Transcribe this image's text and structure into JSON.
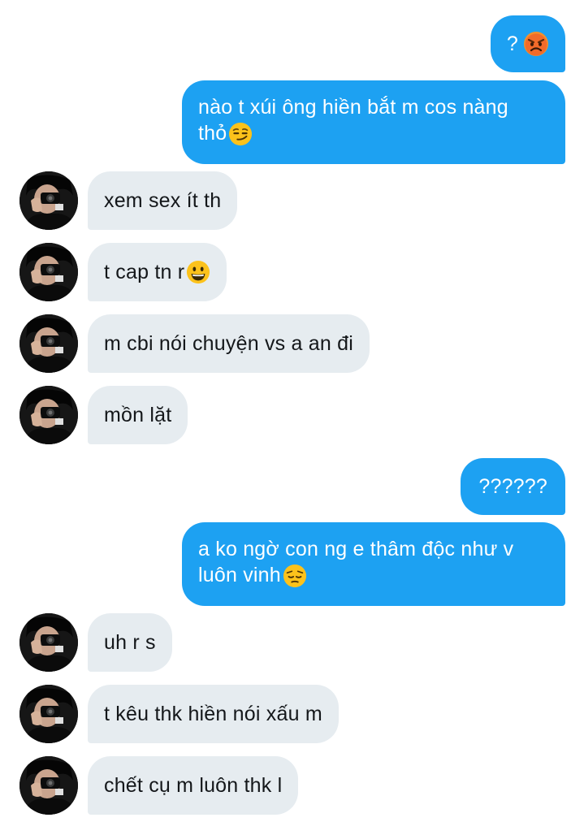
{
  "colors": {
    "outgoing_bubble": "#1da1f2",
    "outgoing_text": "#ffffff",
    "incoming_bubble": "#e6ecf0",
    "incoming_text": "#14171a"
  },
  "messages": [
    {
      "direction": "out",
      "text": "?",
      "emoji": "angry-face"
    },
    {
      "direction": "out",
      "line1": "nào t xúi ông hiền bắt m cos nàng",
      "line2": "thỏ",
      "emoji": "smirking-face"
    },
    {
      "direction": "in",
      "text": "xem sex ít th"
    },
    {
      "direction": "in",
      "text": "t cap tn r",
      "emoji": "grinning-face"
    },
    {
      "direction": "in",
      "text": "m cbi nói chuyện vs a an đi"
    },
    {
      "direction": "in",
      "text": "mồn lặt"
    },
    {
      "direction": "out",
      "text": "??????"
    },
    {
      "direction": "out",
      "line1": "a ko ngờ con ng e thâm độc như v",
      "line2": "luôn vinh",
      "emoji": "pensive-face"
    },
    {
      "direction": "in",
      "text": "uh r s"
    },
    {
      "direction": "in",
      "text": "t kêu thk hiền nói xấu m"
    },
    {
      "direction": "in",
      "text": "chết cụ m luôn thk l"
    }
  ]
}
